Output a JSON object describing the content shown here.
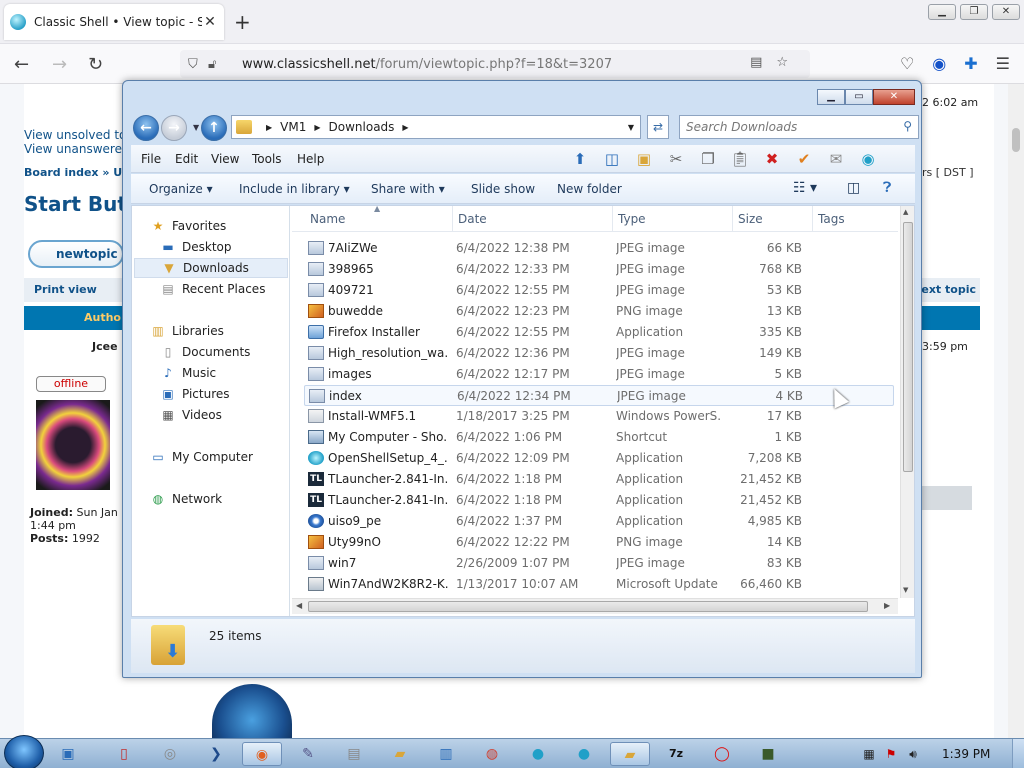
{
  "browser": {
    "tab_title": "Classic Shell • View topic - Start",
    "url_host": "www.classicshell.net",
    "url_path": "/forum/viewtopic.php?f=18&t=3207"
  },
  "page": {
    "time_top": "2 6:02 am",
    "links": [
      "View unsolved to",
      "View unanswered"
    ],
    "crumb": "Board index » U",
    "tz": "rs [ DST ]",
    "heading": "Start Butto",
    "newtopic": "newtopic",
    "print_view": "Print view",
    "next_topic": "Next topic",
    "author_hdr": "Autho",
    "author": "Jcee",
    "post_time": "3:59 pm",
    "offline": "offline",
    "joined_label": "Joined:",
    "joined_value": "Sun Jan",
    "joined_time": "1:44 pm",
    "posts_label": "Posts:",
    "posts_value": "1992"
  },
  "explorer": {
    "path": [
      "VM1",
      "Downloads"
    ],
    "search_placeholder": "Search Downloads",
    "menu": [
      "File",
      "Edit",
      "View",
      "Tools",
      "Help"
    ],
    "commands": [
      "Organize",
      "Include in library",
      "Share with",
      "Slide show",
      "New folder"
    ],
    "nav": {
      "favorites": "Favorites",
      "desktop": "Desktop",
      "downloads": "Downloads",
      "recent": "Recent Places",
      "libraries": "Libraries",
      "documents": "Documents",
      "music": "Music",
      "pictures": "Pictures",
      "videos": "Videos",
      "computer": "My Computer",
      "network": "Network"
    },
    "columns": [
      "Name",
      "Date",
      "Type",
      "Size",
      "Tags"
    ],
    "files": [
      {
        "name": "7AIiZWe",
        "date": "6/4/2022 12:38 PM",
        "type": "JPEG image",
        "size": "66 KB",
        "icon": "jpg"
      },
      {
        "name": "398965",
        "date": "6/4/2022 12:33 PM",
        "type": "JPEG image",
        "size": "768 KB",
        "icon": "jpg"
      },
      {
        "name": "409721",
        "date": "6/4/2022 12:55 PM",
        "type": "JPEG image",
        "size": "53 KB",
        "icon": "jpg"
      },
      {
        "name": "buwedde",
        "date": "6/4/2022 12:23 PM",
        "type": "PNG image",
        "size": "13 KB",
        "icon": "png"
      },
      {
        "name": "Firefox Installer",
        "date": "6/4/2022 12:55 PM",
        "type": "Application",
        "size": "335 KB",
        "icon": "app"
      },
      {
        "name": "High_resolution_wa...",
        "date": "6/4/2022 12:36 PM",
        "type": "JPEG image",
        "size": "149 KB",
        "icon": "jpg"
      },
      {
        "name": "images",
        "date": "6/4/2022 12:17 PM",
        "type": "JPEG image",
        "size": "5 KB",
        "icon": "jpg"
      },
      {
        "name": "index",
        "date": "6/4/2022 12:34 PM",
        "type": "JPEG image",
        "size": "4 KB",
        "icon": "jpg"
      },
      {
        "name": "Install-WMF5.1",
        "date": "1/18/2017 3:25 PM",
        "type": "Windows PowerS...",
        "size": "17 KB",
        "icon": "ps"
      },
      {
        "name": "My Computer - Sho...",
        "date": "6/4/2022 1:06 PM",
        "type": "Shortcut",
        "size": "1 KB",
        "icon": "lnk"
      },
      {
        "name": "OpenShellSetup_4_...",
        "date": "6/4/2022 12:09 PM",
        "type": "Application",
        "size": "7,208 KB",
        "icon": "exe"
      },
      {
        "name": "TLauncher-2.841-In...",
        "date": "6/4/2022 1:18 PM",
        "type": "Application",
        "size": "21,452 KB",
        "icon": "tl"
      },
      {
        "name": "TLauncher-2.841-In...",
        "date": "6/4/2022 1:18 PM",
        "type": "Application",
        "size": "21,452 KB",
        "icon": "tl"
      },
      {
        "name": "uiso9_pe",
        "date": "6/4/2022 1:37 PM",
        "type": "Application",
        "size": "4,985 KB",
        "icon": "iso"
      },
      {
        "name": "Uty99nO",
        "date": "6/4/2022 12:22 PM",
        "type": "PNG image",
        "size": "14 KB",
        "icon": "png"
      },
      {
        "name": "win7",
        "date": "2/26/2009 1:07 PM",
        "type": "JPEG image",
        "size": "83 KB",
        "icon": "jpg"
      },
      {
        "name": "Win7AndW2K8R2-K...",
        "date": "1/13/2017 10:07 AM",
        "type": "Microsoft Update ...",
        "size": "66,460 KB",
        "icon": "msu"
      }
    ],
    "highlight_index": 7,
    "item_count": "25 items"
  },
  "taskbar": {
    "clock": "1:39 PM"
  }
}
